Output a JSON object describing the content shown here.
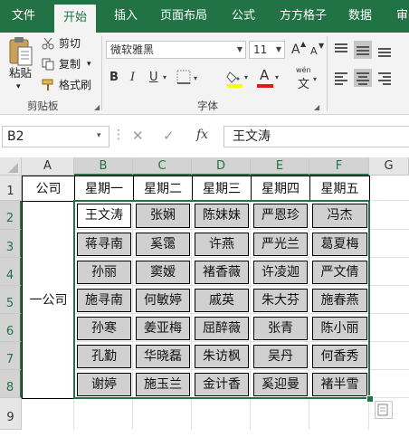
{
  "ribbon": {
    "tabs": [
      "文件",
      "开始",
      "插入",
      "页面布局",
      "公式",
      "方方格子",
      "数据",
      "审阅"
    ],
    "clipboard": {
      "paste": "粘贴",
      "cut": "剪切",
      "copy": "复制",
      "format_painter": "格式刷",
      "group_label": "剪贴板"
    },
    "font": {
      "name": "微软雅黑",
      "size": "11",
      "group_label": "字体",
      "bold": "B",
      "italic": "I",
      "underline": "U",
      "grow": "A",
      "shrink": "A",
      "font_color": "A",
      "phonetic": "wén"
    }
  },
  "formula_bar": {
    "name_box": "B2",
    "formula": "王文涛",
    "fx": "fx"
  },
  "sheet": {
    "columns": [
      "A",
      "B",
      "C",
      "D",
      "E",
      "F",
      "G"
    ],
    "rows": [
      "1",
      "2",
      "3",
      "4",
      "5",
      "6",
      "7",
      "8",
      "9"
    ],
    "header": [
      "公司",
      "星期一",
      "星期二",
      "星期三",
      "星期四",
      "星期五"
    ],
    "company": "一公司",
    "names": [
      [
        "王文涛",
        "张娴",
        "陈妹妹",
        "严恩珍",
        "冯杰"
      ],
      [
        "蒋寻南",
        "奚霭",
        "许燕",
        "严光兰",
        "葛夏梅"
      ],
      [
        "孙丽",
        "窦嫒",
        "褚香薇",
        "许凌迦",
        "严文倩"
      ],
      [
        "施寻南",
        "何敏婷",
        "戚英",
        "朱大芬",
        "施春燕"
      ],
      [
        "孙寒",
        "姜亚梅",
        "屈醉薇",
        "张青",
        "陈小丽"
      ],
      [
        "孔勤",
        "华晓磊",
        "朱访枫",
        "吴丹",
        "何香秀"
      ],
      [
        "谢婷",
        "施玉兰",
        "金计香",
        "奚迎曼",
        "褚半雪"
      ]
    ]
  },
  "colors": {
    "accent": "#217346",
    "selection_fill": "#d0d0d0",
    "font_color_bar": "#e0191c",
    "highlight_bar": "#ffff00"
  }
}
